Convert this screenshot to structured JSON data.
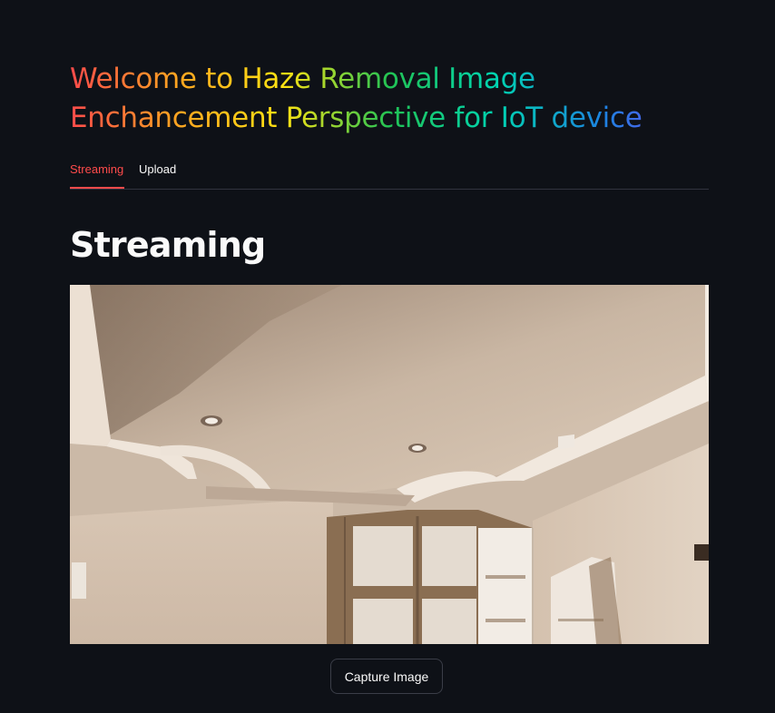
{
  "header": {
    "title": "Welcome to Haze Removal Image Enchancement Perspective for IoT device"
  },
  "tabs": [
    {
      "label": "Streaming",
      "active": true
    },
    {
      "label": "Upload",
      "active": false
    }
  ],
  "main": {
    "heading": "Streaming",
    "capture_button": "Capture Image"
  },
  "colors": {
    "background": "#0e1117",
    "accent": "#ff4b4b",
    "text": "#fafafa",
    "title_gradient": [
      "#ff4b4b",
      "#ffa421",
      "#ffe312",
      "#21c354",
      "#00d4b1",
      "#1c83e1",
      "#803df5"
    ]
  }
}
